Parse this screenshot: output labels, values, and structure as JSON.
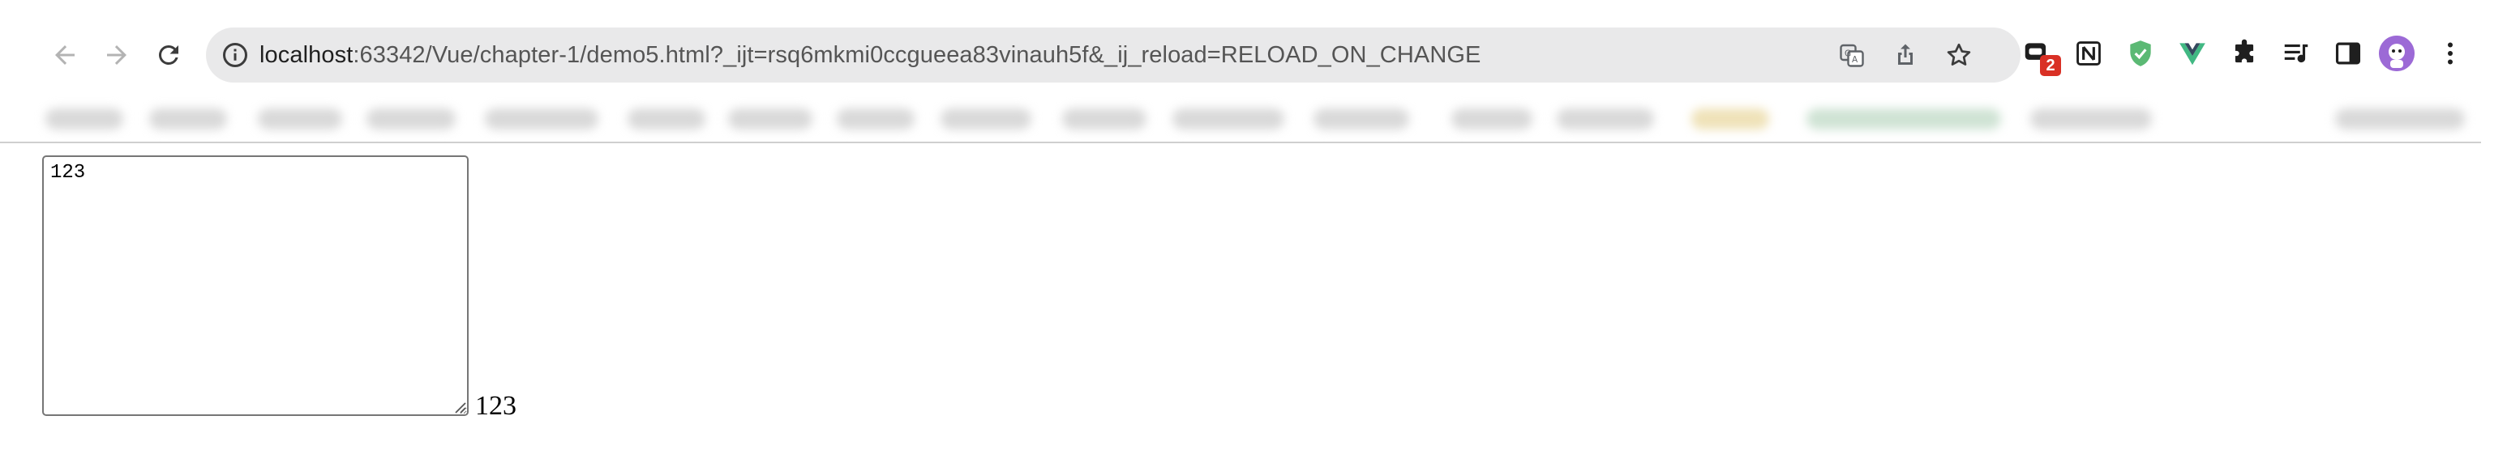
{
  "browser": {
    "url_host": "localhost",
    "url_rest": ":63342/Vue/chapter-1/demo5.html?_ijt=rsq6mkmi0ccgueea83vinauh5f&_ij_reload=RELOAD_ON_CHANGE",
    "extension_badge": "2",
    "accent_color": "#1a73e8"
  },
  "page": {
    "textarea_value": "123",
    "echo_text": "123"
  }
}
